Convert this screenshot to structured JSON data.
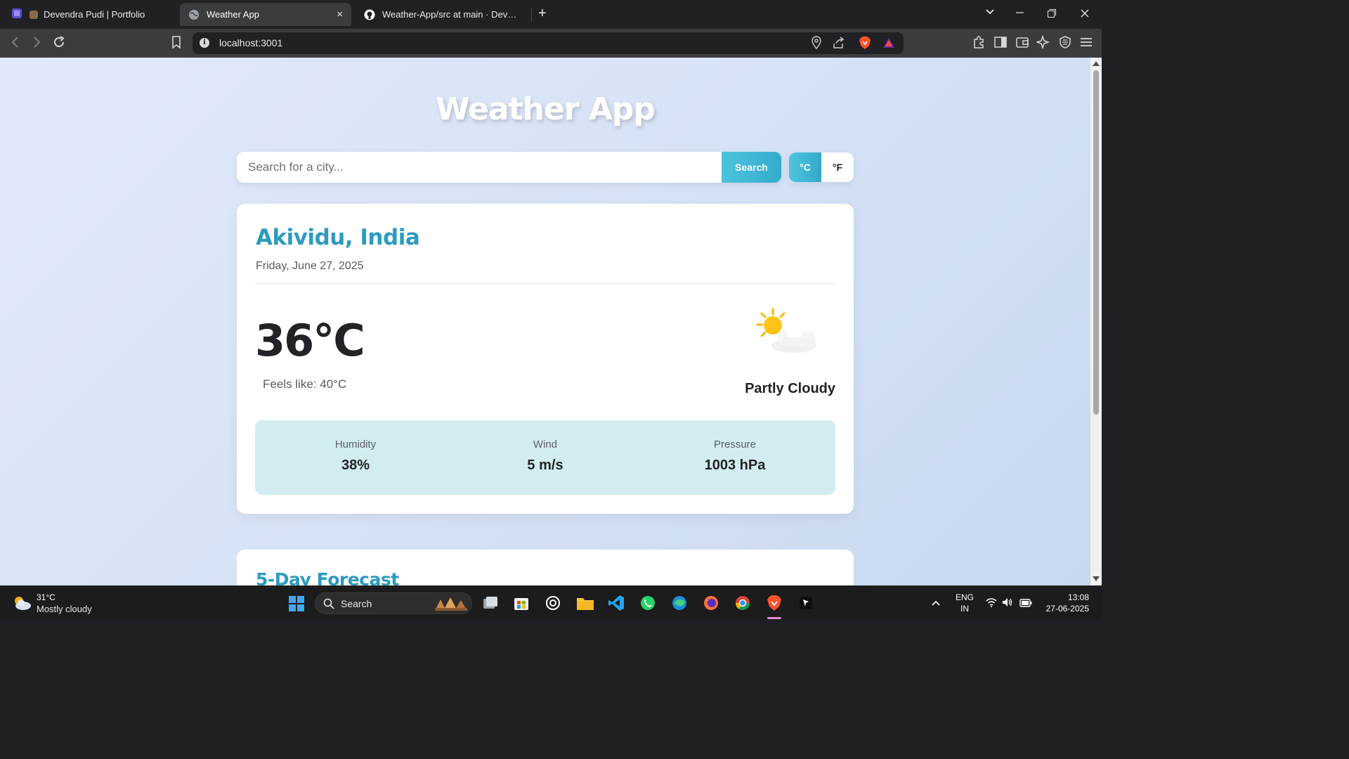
{
  "browser": {
    "tabs": [
      {
        "title": "Devendra Pudi | Portfolio"
      },
      {
        "title": "Weather App",
        "close": "×"
      },
      {
        "title": "Weather-App/src at main · Devendra"
      }
    ],
    "new_tab_label": "+",
    "url": "localhost:3001",
    "info_icon_text": "i"
  },
  "page": {
    "app_title": "Weather App",
    "search": {
      "placeholder": "Search for a city...",
      "button_label": "Search"
    },
    "units": {
      "celsius": "°C",
      "fahrenheit": "°F",
      "selected": "celsius"
    },
    "current": {
      "city": "Akividu, India",
      "date": "Friday, June 27, 2025",
      "temperature": "36°C",
      "feels_like": "Feels like: 40°C",
      "condition": "Partly Cloudy",
      "condition_icon": "partly-cloudy-icon"
    },
    "stats": [
      {
        "label": "Humidity",
        "value": "38%"
      },
      {
        "label": "Wind",
        "value": "5 m/s"
      },
      {
        "label": "Pressure",
        "value": "1003 hPa"
      }
    ],
    "forecast_title": "5-Day Forecast"
  },
  "taskbar": {
    "weather_temp": "31°C",
    "weather_desc": "Mostly cloudy",
    "search_label": "Search",
    "language_line1": "ENG",
    "language_line2": "IN",
    "time": "13:08",
    "date": "27-06-2025"
  },
  "colors": {
    "accent": "#2d9bbf",
    "button": "#35aacc",
    "stats_bg": "#d2ecf2",
    "page_bg": "#d6e2f5"
  }
}
